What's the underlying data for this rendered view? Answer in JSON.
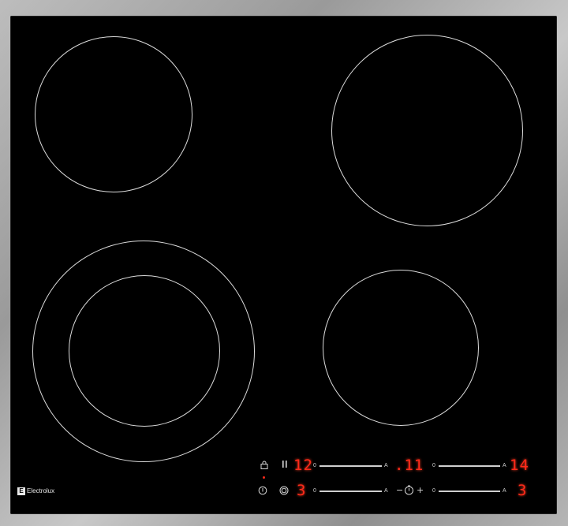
{
  "brand": {
    "name": "Electrolux"
  },
  "zones": [
    {
      "id": "back-left"
    },
    {
      "id": "back-right"
    },
    {
      "id": "front-left-dual"
    },
    {
      "id": "front-right"
    }
  ],
  "controls": {
    "row1": {
      "lock_icon": "lock-icon",
      "pause_icon": "pause-icon",
      "zone1_display": "12",
      "slider1_min": "0",
      "slider1_auto": "A",
      "timer_display": ".11",
      "slider2_min": "0",
      "slider2_auto": "A",
      "zone2_display": "14"
    },
    "row2": {
      "power_icon": "power-icon",
      "dual_zone_icon": "dual-zone-icon",
      "zone3_display": "3",
      "slider3_min": "0",
      "slider3_auto": "A",
      "timer_minus": "−",
      "timer_icon": "timer-icon",
      "timer_plus": "+",
      "slider4_min": "0",
      "slider4_auto": "A",
      "zone4_display": "3"
    }
  },
  "colors": {
    "glass": "#000000",
    "display_red": "#ff2a1a",
    "frame": "#a8a8a8"
  }
}
